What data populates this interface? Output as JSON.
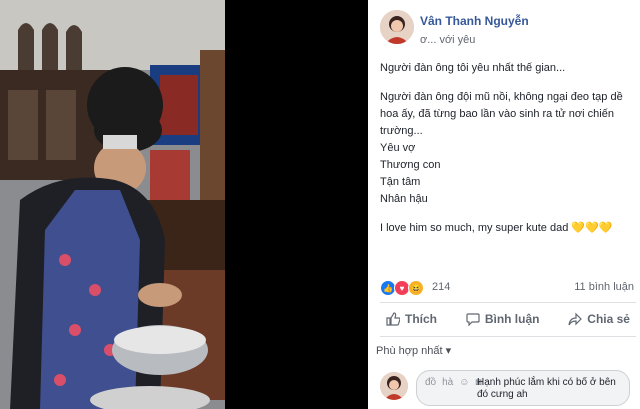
{
  "post": {
    "author": "Vân Thanh Nguyễn",
    "with_text": "ơ... với yêu",
    "lines": [
      "Người đàn ông tôi yêu nhất thế gian...",
      "",
      "Người đàn ông đội mũ nồi, không ngại đeo tạp dề hoa ấy, đã từng bao lần vào sinh ra tử nơi chiến trường...",
      "Yêu vợ",
      "Thương con",
      "Tận tâm",
      "Nhân hậu",
      "",
      "I love him so much, my super kute dad"
    ],
    "hearts": "💛💛💛"
  },
  "reactions": {
    "count": "214",
    "comments_count": "11 bình luận",
    "icons": [
      "like-icon",
      "heart-icon",
      "haha-icon"
    ]
  },
  "actions": {
    "like_label": "Thích",
    "comment_label": "Bình luận",
    "share_label": "Chia sẻ"
  },
  "sort_label": "Phù hợp nhất ▾",
  "comment": {
    "text": "Hạnh phúc lắm khi có bố ở bên đó cưng ah",
    "tools": [
      "đồ",
      "hà"
    ]
  },
  "colors": {
    "link": "#365899",
    "bubble_bg": "#f2f3f5",
    "hearts": "#f7c40d"
  }
}
